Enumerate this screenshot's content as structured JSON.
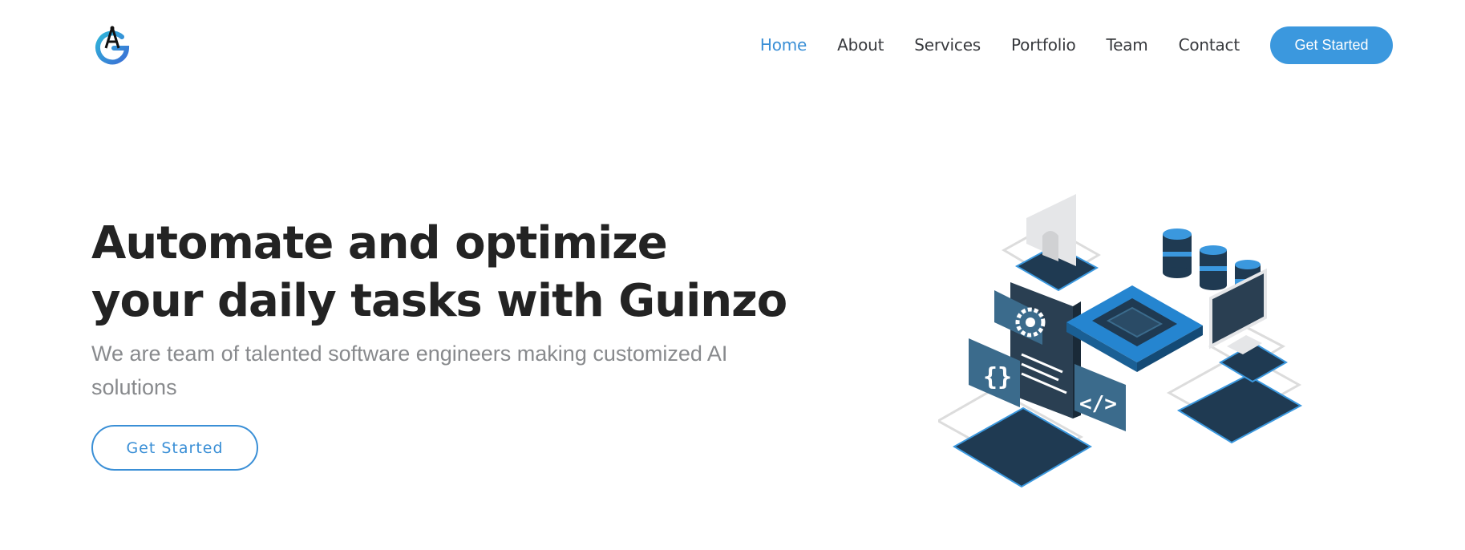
{
  "nav": {
    "items": [
      {
        "label": "Home",
        "active": true
      },
      {
        "label": "About",
        "active": false
      },
      {
        "label": "Services",
        "active": false
      },
      {
        "label": "Portfolio",
        "active": false
      },
      {
        "label": "Team",
        "active": false
      },
      {
        "label": "Contact",
        "active": false
      }
    ],
    "cta_label": "Get Started"
  },
  "hero": {
    "title_line1": "Automate and optimize",
    "title_line2": "your daily tasks with Guinzo",
    "subtitle": "We are team of talented software engineers making customized AI solutions",
    "cta_label": "Get Started"
  },
  "illustration": {
    "code_braces": "{}",
    "code_tag": "</>"
  },
  "colors": {
    "accent": "#3b98de",
    "nav_active": "#3a8fd6",
    "title": "#232323",
    "subtitle": "#888a8d",
    "dark_navy": "#1f3a52",
    "slate": "#3b6b8c"
  }
}
